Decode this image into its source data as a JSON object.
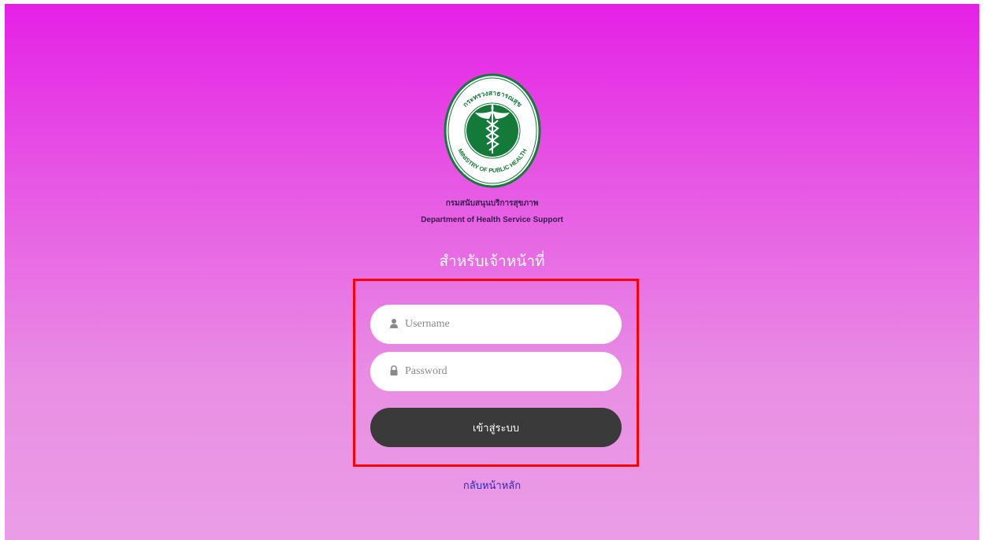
{
  "header": {
    "logo_name": "ministry-of-public-health-seal",
    "logo_text_top": "กระทรวงสาธารณสุข",
    "logo_text_bottom": "MINISTRY OF PUBLIC HEALTH",
    "department_th": "กรมสนับสนุนบริการสุขภาพ",
    "department_en": "Department of Health Service Support",
    "subtitle": "สำหรับเจ้าหน้าที่"
  },
  "login": {
    "username_placeholder": "Username",
    "username_value": "",
    "password_placeholder": "Password",
    "password_value": "",
    "submit_label": "เข้าสู่ระบบ"
  },
  "footer": {
    "back_link": "กลับหน้าหลัก"
  },
  "colors": {
    "background_top": "#e520e6",
    "background_bottom": "#ea9de6",
    "highlight_border": "#ff0000",
    "button": "#3b3a3a",
    "link": "#2a2ac0",
    "seal_green": "#137a3a"
  },
  "icons": {
    "username": "user-icon",
    "password": "lock-icon"
  }
}
